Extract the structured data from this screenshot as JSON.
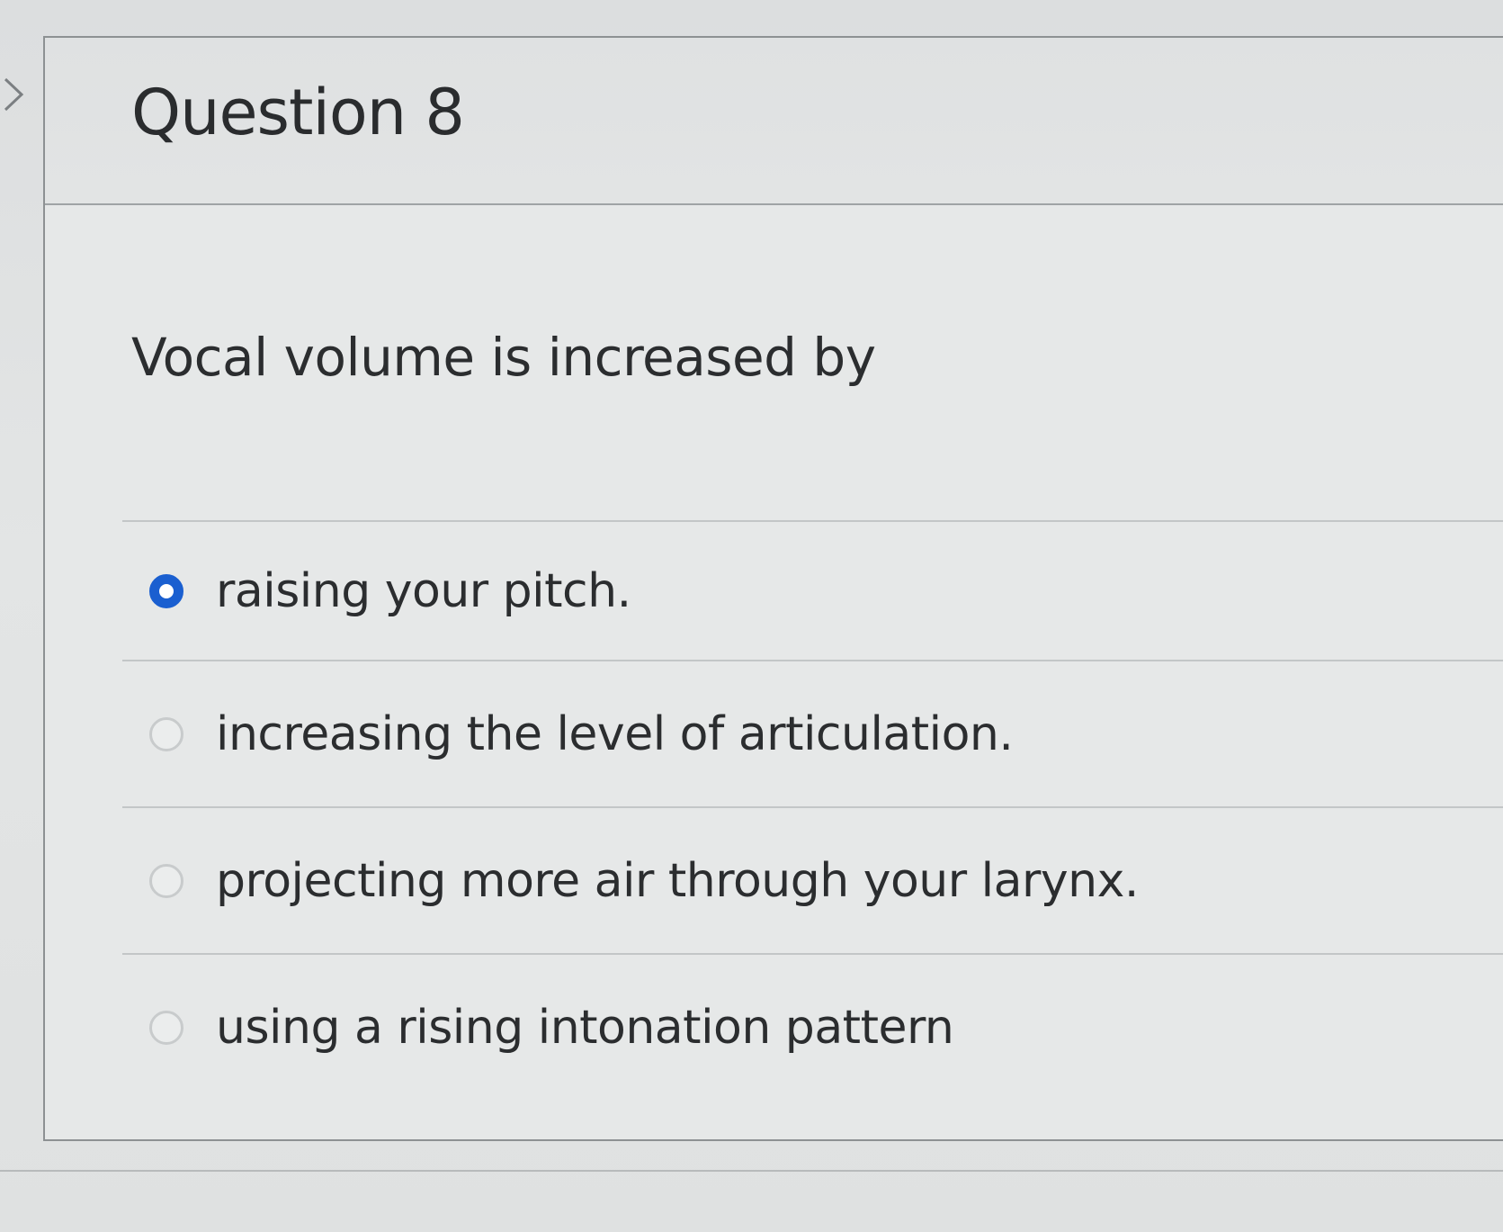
{
  "question": {
    "title": "Question 8",
    "prompt": "Vocal volume is increased by"
  },
  "answers": [
    {
      "label": "raising your pitch.",
      "selected": true
    },
    {
      "label": "increasing the level of articulation.",
      "selected": false
    },
    {
      "label": "projecting more air through your larynx.",
      "selected": false
    },
    {
      "label": "using a rising intonation pattern",
      "selected": false
    }
  ],
  "colors": {
    "selected_radio": "#1a5fd0",
    "text": "#2b2d2f"
  },
  "icons": {
    "side": "chevron-right-icon"
  }
}
